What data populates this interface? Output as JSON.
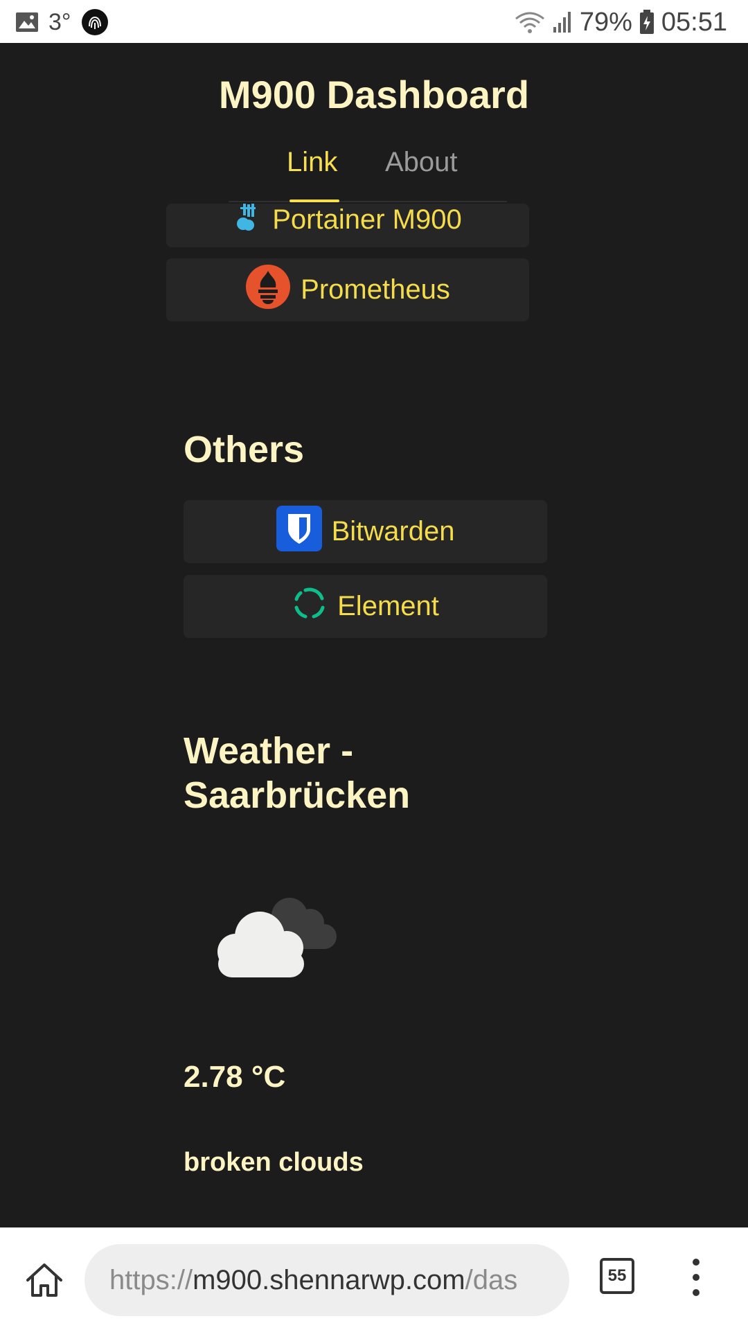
{
  "status_bar": {
    "temperature": "3°",
    "battery": "79%",
    "time": "05:51"
  },
  "header": {
    "title": "M900 Dashboard",
    "tabs": [
      {
        "label": "Link",
        "active": true
      },
      {
        "label": "About",
        "active": false
      }
    ]
  },
  "links_top": [
    {
      "label": "Portainer M900",
      "icon": "portainer-icon"
    },
    {
      "label": "Prometheus",
      "icon": "prometheus-icon"
    }
  ],
  "others": {
    "heading": "Others",
    "links": [
      {
        "label": "Bitwarden",
        "icon": "bitwarden-icon"
      },
      {
        "label": "Element",
        "icon": "element-icon"
      }
    ]
  },
  "weather": {
    "heading": "Weather - Saarbrücken",
    "icon": "broken-clouds-icon",
    "temperature": "2.78 °C",
    "description": "broken clouds"
  },
  "browser": {
    "url_scheme": "https://",
    "url_host": "m900.shennarwp.com",
    "url_path": "/das",
    "tab_count": "55"
  },
  "colors": {
    "background": "#1c1c1c",
    "button_bg": "#262626",
    "accent_yellow": "#f4dc4c",
    "heading_cream": "#fdf4c4"
  }
}
